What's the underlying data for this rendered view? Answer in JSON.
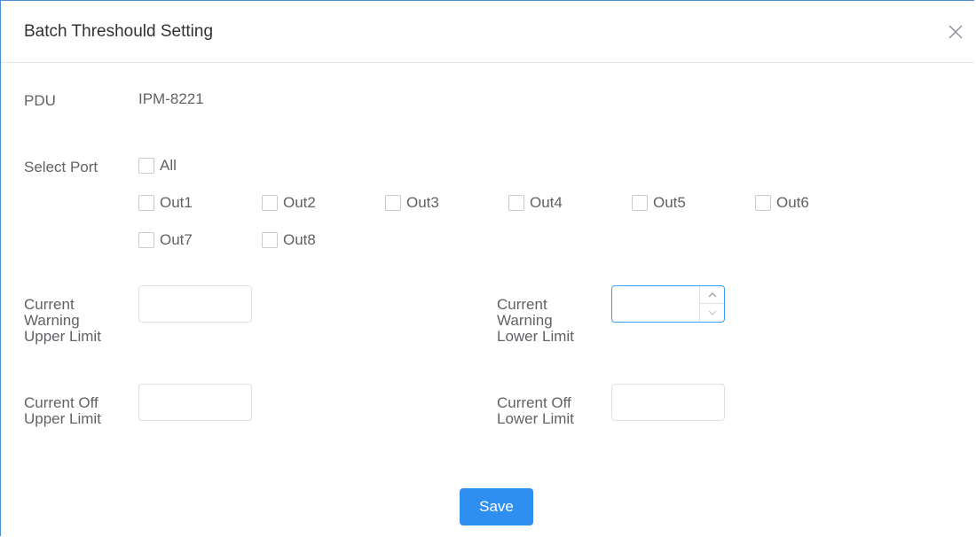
{
  "dialog": {
    "title": "Batch Threshould Setting"
  },
  "pdu": {
    "label": "PDU",
    "value": "IPM-8221"
  },
  "ports": {
    "label": "Select Port",
    "all_label": "All",
    "items": [
      "Out1",
      "Out2",
      "Out3",
      "Out4",
      "Out5",
      "Out6",
      "Out7",
      "Out8"
    ]
  },
  "limits": {
    "warning_upper": {
      "line1": "Current",
      "line2": "Warning",
      "line3": "Upper Limit",
      "value": ""
    },
    "warning_lower": {
      "line1": "Current",
      "line2": "Warning",
      "line3": "Lower Limit",
      "value": ""
    },
    "off_upper": {
      "line1": "Current Off",
      "line2": "Upper Limit",
      "value": ""
    },
    "off_lower": {
      "line1": "Current Off",
      "line2": "Lower Limit",
      "value": ""
    }
  },
  "actions": {
    "save_label": "Save"
  },
  "colors": {
    "accent": "#2f8ff0",
    "focus_border": "#409eff"
  }
}
